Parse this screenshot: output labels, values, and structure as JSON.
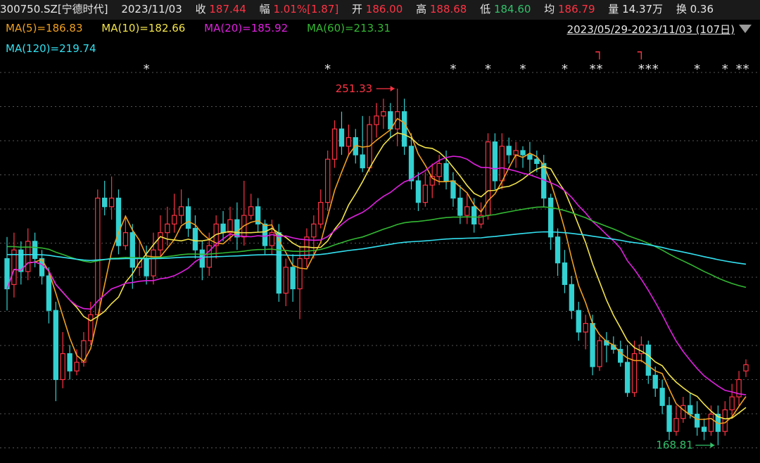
{
  "header": {
    "code": "300750.SZ[宁德时代]",
    "date": "2023/11/03",
    "close_label": "收",
    "close_value": "187.44",
    "change_label": "幅",
    "change_value": "1.01%[1.87]",
    "open_label": "开",
    "open_value": "186.00",
    "high_label": "高",
    "high_value": "188.68",
    "low_label": "低",
    "low_value": "184.60",
    "avg_label": "均",
    "avg_value": "186.79",
    "vol_label": "量",
    "vol_value": "14.37万",
    "turnover_label": "换",
    "turnover_value": "0.36"
  },
  "ma_legend": [
    {
      "label": "MA(5)=186.83",
      "color": "#f0a020"
    },
    {
      "label": "MA(10)=182.66",
      "color": "#f2e34a"
    },
    {
      "label": "MA(20)=185.92",
      "color": "#e020e0"
    },
    {
      "label": "MA(60)=213.31",
      "color": "#33b833"
    },
    {
      "label": "MA(120)=219.74",
      "color": "#33e0f0"
    }
  ],
  "date_range": "2023/05/29-2023/11/03 (107日)",
  "colors": {
    "up": "#ff3344",
    "down": "#33d1d1",
    "grid": "#555555",
    "text": "#e6e6e6"
  },
  "chart_data": {
    "type": "candlestick",
    "days": 107,
    "ylim": [
      166,
      258
    ],
    "annotations": {
      "high_label": "251.33",
      "low_label": "168.81"
    },
    "candles": [
      [
        212,
        205,
        217,
        200
      ],
      [
        206,
        214,
        218,
        203
      ],
      [
        214,
        209,
        216,
        206
      ],
      [
        209,
        216,
        219,
        207
      ],
      [
        216,
        212,
        218,
        210
      ],
      [
        212,
        208,
        214,
        206
      ],
      [
        208,
        200,
        210,
        197
      ],
      [
        200,
        184,
        202,
        179
      ],
      [
        184,
        190,
        195,
        182
      ],
      [
        190,
        186,
        192,
        184
      ],
      [
        186,
        188,
        191,
        185
      ],
      [
        188,
        193,
        195,
        187
      ],
      [
        193,
        199,
        202,
        192
      ],
      [
        199,
        226,
        228,
        198
      ],
      [
        226,
        224,
        230,
        222
      ],
      [
        224,
        226,
        231,
        221
      ],
      [
        226,
        215,
        228,
        213
      ],
      [
        215,
        218,
        222,
        214
      ],
      [
        218,
        210,
        220,
        205
      ],
      [
        210,
        212,
        216,
        208
      ],
      [
        212,
        208,
        215,
        206
      ],
      [
        208,
        214,
        218,
        206
      ],
      [
        214,
        218,
        222,
        212
      ],
      [
        218,
        220,
        224,
        215
      ],
      [
        220,
        222,
        227,
        218
      ],
      [
        222,
        224,
        228,
        220
      ],
      [
        224,
        219,
        226,
        217
      ],
      [
        219,
        214,
        222,
        212
      ],
      [
        214,
        210,
        216,
        207
      ],
      [
        210,
        215,
        218,
        208
      ],
      [
        215,
        220,
        222,
        212
      ],
      [
        220,
        218,
        223,
        216
      ],
      [
        218,
        221,
        224,
        216
      ],
      [
        221,
        217,
        225,
        214
      ],
      [
        217,
        222,
        230,
        215
      ],
      [
        222,
        224,
        227,
        221
      ],
      [
        224,
        220,
        226,
        218
      ],
      [
        220,
        215,
        221,
        213
      ],
      [
        215,
        218,
        221,
        213
      ],
      [
        218,
        204,
        220,
        202
      ],
      [
        204,
        210,
        212,
        201
      ],
      [
        210,
        205,
        213,
        202
      ],
      [
        205,
        212,
        215,
        198
      ],
      [
        212,
        217,
        219,
        210
      ],
      [
        217,
        220,
        222,
        212
      ],
      [
        220,
        225,
        228,
        219
      ],
      [
        225,
        235,
        237,
        223
      ],
      [
        235,
        242,
        244,
        233
      ],
      [
        242,
        238,
        246,
        236
      ],
      [
        238,
        240,
        243,
        236
      ],
      [
        240,
        236,
        242,
        234
      ],
      [
        236,
        233,
        245,
        232
      ],
      [
        233,
        243,
        245,
        232
      ],
      [
        243,
        245,
        248,
        240
      ],
      [
        245,
        246,
        249,
        242
      ],
      [
        246,
        242,
        248,
        240
      ],
      [
        242,
        246,
        251.33,
        238
      ],
      [
        246,
        238,
        249,
        236
      ],
      [
        238,
        230,
        241,
        228
      ],
      [
        230,
        225,
        232,
        223
      ],
      [
        225,
        229,
        232,
        224
      ],
      [
        229,
        231,
        234,
        226
      ],
      [
        231,
        234,
        236,
        229
      ],
      [
        234,
        230,
        237,
        228
      ],
      [
        230,
        226,
        232,
        224
      ],
      [
        226,
        222,
        229,
        220
      ],
      [
        222,
        224,
        227,
        220
      ],
      [
        224,
        220,
        226,
        218
      ],
      [
        220,
        222,
        225,
        219
      ],
      [
        222,
        239,
        241,
        221
      ],
      [
        239,
        230,
        241,
        228
      ],
      [
        230,
        238,
        241,
        228
      ],
      [
        238,
        236,
        240,
        234
      ],
      [
        236,
        237,
        239,
        233
      ],
      [
        237,
        236,
        238,
        233
      ],
      [
        236,
        235,
        239,
        232
      ],
      [
        235,
        234,
        237,
        232
      ],
      [
        234,
        226,
        236,
        224
      ],
      [
        226,
        217,
        227,
        214
      ],
      [
        217,
        211,
        219,
        208
      ],
      [
        211,
        206,
        214,
        204
      ],
      [
        206,
        200,
        208,
        198
      ],
      [
        200,
        195,
        202,
        193
      ],
      [
        195,
        197,
        199,
        191
      ],
      [
        197,
        187,
        199,
        185
      ],
      [
        187,
        193,
        194,
        186
      ],
      [
        193,
        192,
        195,
        188
      ],
      [
        192,
        191,
        194,
        190
      ],
      [
        191,
        188,
        193,
        187
      ],
      [
        188,
        181,
        192,
        180
      ],
      [
        181,
        190,
        193,
        180
      ],
      [
        190,
        192,
        194,
        188
      ],
      [
        192,
        185,
        193,
        183
      ],
      [
        185,
        182,
        187,
        180
      ],
      [
        182,
        178,
        184,
        176
      ],
      [
        178,
        172,
        180,
        170
      ],
      [
        172,
        175,
        178,
        171
      ],
      [
        175,
        178,
        180,
        174
      ],
      [
        178,
        176,
        181,
        175
      ],
      [
        176,
        173,
        179,
        171
      ],
      [
        173,
        172,
        175,
        170
      ],
      [
        172,
        176,
        178,
        171
      ],
      [
        176,
        172,
        178,
        168.81
      ],
      [
        172,
        177,
        179,
        171
      ],
      [
        177,
        180,
        183,
        175
      ],
      [
        180,
        184,
        186,
        178
      ],
      [
        186,
        187.44,
        188.68,
        184.6
      ]
    ],
    "markers": [
      {
        "index": 20,
        "text": "*"
      },
      {
        "index": 46,
        "text": "*"
      },
      {
        "index": 64,
        "text": "*"
      },
      {
        "index": 69,
        "text": "*"
      },
      {
        "index": 74,
        "text": "*"
      },
      {
        "index": 80,
        "text": "*"
      },
      {
        "index": 84,
        "text": "*"
      },
      {
        "index": 85,
        "text": "*"
      },
      {
        "index": 91,
        "text": "*"
      },
      {
        "index": 92,
        "text": "*"
      },
      {
        "index": 93,
        "text": "*"
      },
      {
        "index": 99,
        "text": "*"
      },
      {
        "index": 103,
        "text": "*"
      },
      {
        "index": 105,
        "text": "*"
      },
      {
        "index": 106,
        "text": "*"
      }
    ],
    "flags": [
      {
        "index": 85,
        "text": "┐"
      },
      {
        "index": 91,
        "text": "┐"
      }
    ],
    "ma60_start": 215,
    "ma120_start": 213
  }
}
